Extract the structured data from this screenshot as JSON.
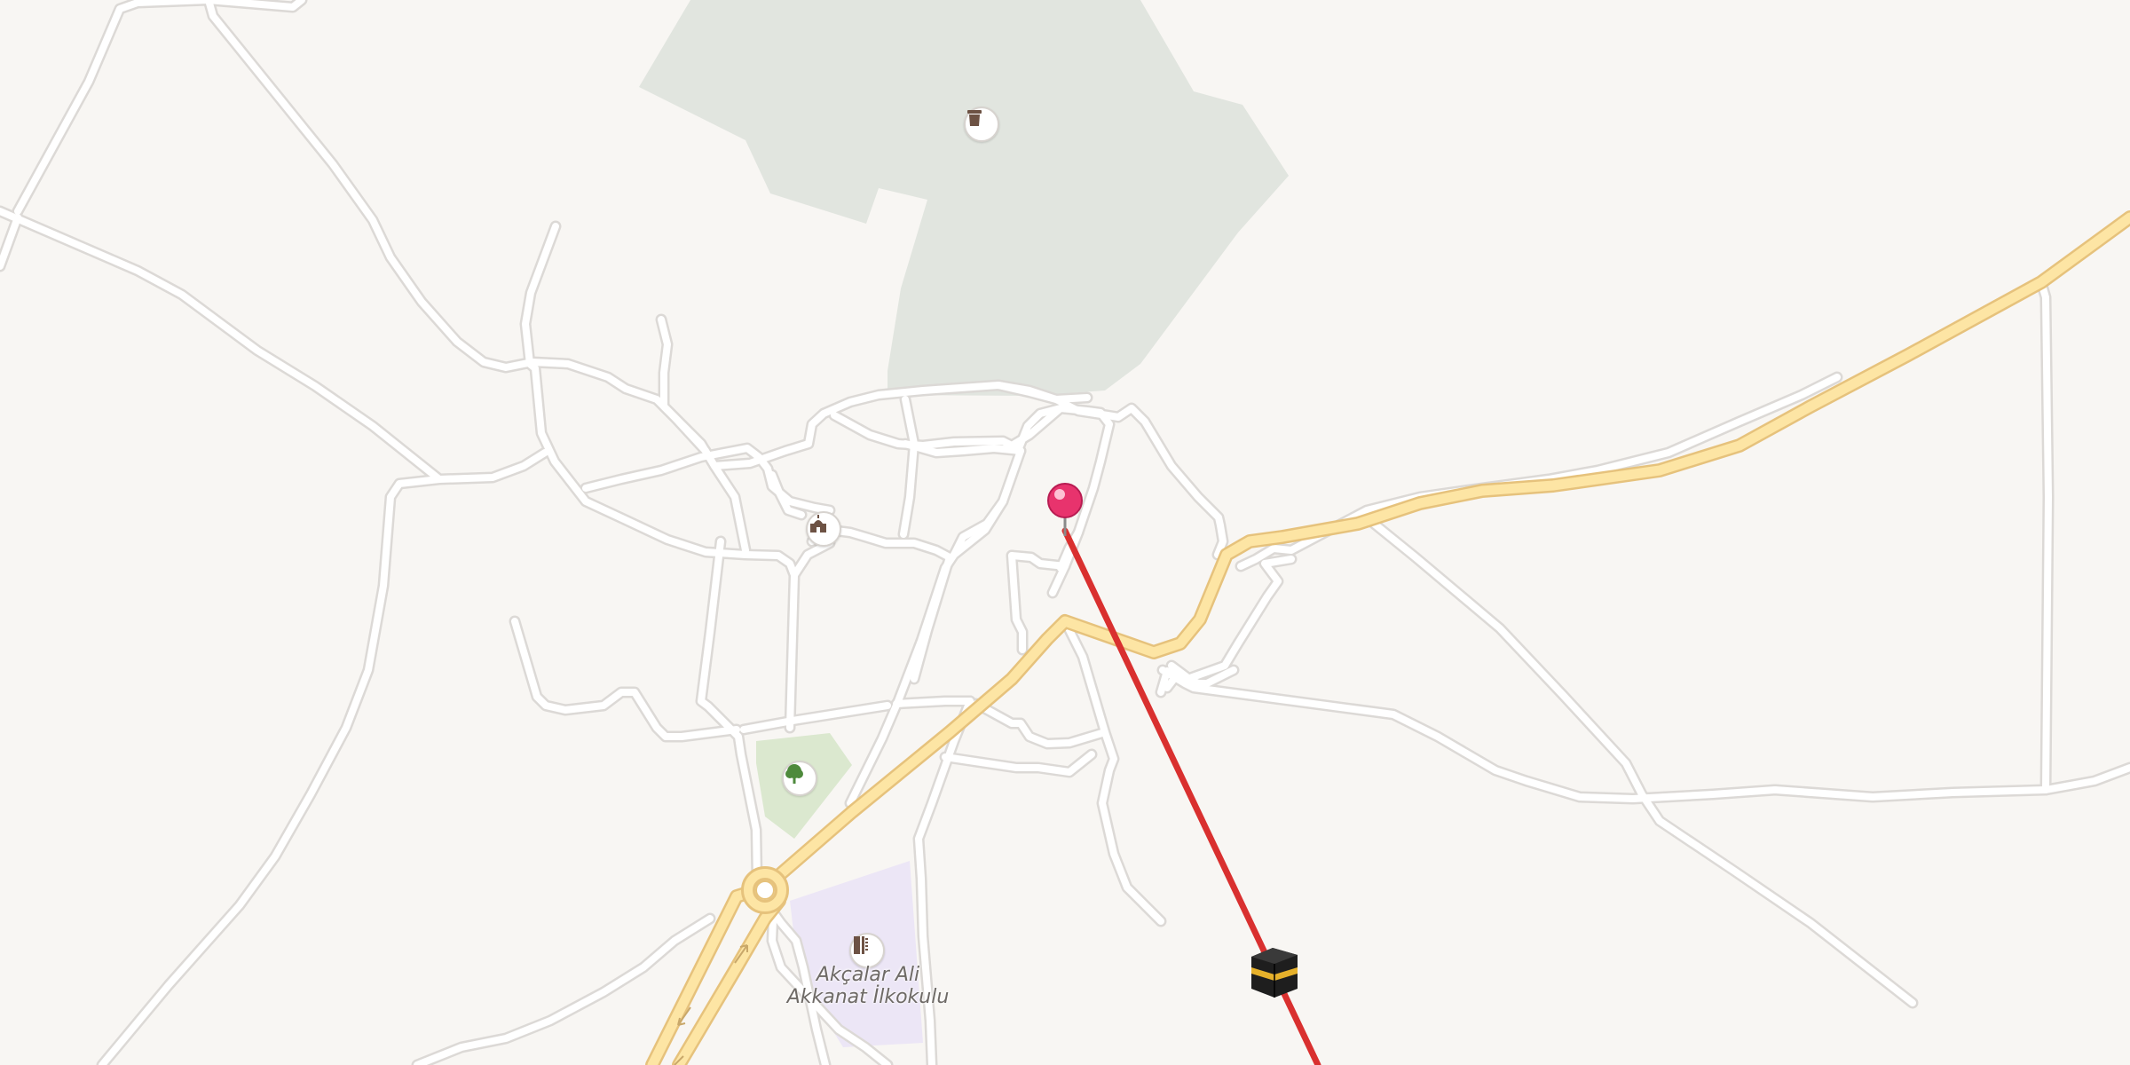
{
  "map": {
    "colors": {
      "background": "#f8f6f3",
      "road": "#ffffff",
      "main_road": "#fde5a4",
      "park": "#e1e5df",
      "garden": "#dbe8cf",
      "school_area": "#ece6f6",
      "route_line": "#d9302f",
      "pin": "#e8336d"
    },
    "pois": {
      "cemetery": {
        "icon": "cemetery-icon"
      },
      "mosque": {
        "icon": "mosque-icon"
      },
      "park": {
        "icon": "tree-icon"
      },
      "school": {
        "icon": "school-icon",
        "label_line1": "Akçalar Ali",
        "label_line2": "Akkanat İlkokulu"
      }
    },
    "markers": {
      "location_pin": {
        "icon": "map-pin-icon"
      },
      "qibla_target": {
        "icon": "kaaba-icon"
      }
    }
  }
}
